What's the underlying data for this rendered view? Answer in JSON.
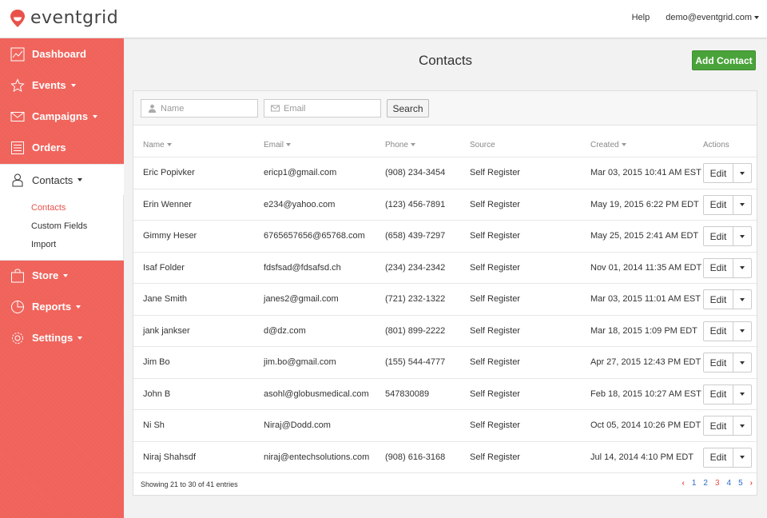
{
  "brand": {
    "name": "eventgrid",
    "color": "#e8524a"
  },
  "header": {
    "help": "Help",
    "user": "demo@eventgrid.com"
  },
  "sidebar": {
    "items": [
      {
        "label": "Dashboard",
        "icon": "chart-icon"
      },
      {
        "label": "Events",
        "icon": "star-icon"
      },
      {
        "label": "Campaigns",
        "icon": "envelope-icon"
      },
      {
        "label": "Orders",
        "icon": "list-icon"
      },
      {
        "label": "Contacts",
        "icon": "person-icon"
      },
      {
        "label": "Store",
        "icon": "bag-icon"
      },
      {
        "label": "Reports",
        "icon": "pie-icon"
      },
      {
        "label": "Settings",
        "icon": "gear-icon"
      }
    ],
    "subitems": [
      "Contacts",
      "Custom Fields",
      "Import"
    ]
  },
  "page": {
    "title": "Contacts",
    "add_label": "Add Contact"
  },
  "filters": {
    "name_placeholder": "Name",
    "email_placeholder": "Email",
    "search_label": "Search"
  },
  "table": {
    "columns": [
      "Name",
      "Email",
      "Phone",
      "Source",
      "Created",
      "Actions"
    ],
    "edit_label": "Edit",
    "rows": [
      {
        "name": "Eric Popivker",
        "email": "ericp1@gmail.com",
        "phone": "(908) 234-3454",
        "source": "Self Register",
        "created": "Mar 03, 2015 10:41 AM EST"
      },
      {
        "name": "Erin Wenner",
        "email": "e234@yahoo.com",
        "phone": "(123) 456-7891",
        "source": "Self Register",
        "created": "May 19, 2015 6:22 PM EDT"
      },
      {
        "name": "Gimmy Heser",
        "email": "6765657656@65768.com",
        "phone": "(658) 439-7297",
        "source": "Self Register",
        "created": "May 25, 2015 2:41 AM EDT"
      },
      {
        "name": "Isaf Folder",
        "email": "fdsfsad@fdsafsd.ch",
        "phone": "(234) 234-2342",
        "source": "Self Register",
        "created": "Nov 01, 2014 11:35 AM EDT"
      },
      {
        "name": "Jane Smith",
        "email": "janes2@gmail.com",
        "phone": "(721) 232-1322",
        "source": "Self Register",
        "created": "Mar 03, 2015 11:01 AM EST"
      },
      {
        "name": "jank jankser",
        "email": "d@dz.com",
        "phone": "(801) 899-2222",
        "source": "Self Register",
        "created": "Mar 18, 2015 1:09 PM EDT"
      },
      {
        "name": "Jim Bo",
        "email": "jim.bo@gmail.com",
        "phone": "(155) 544-4777",
        "source": "Self Register",
        "created": "Apr 27, 2015 12:43 PM EDT"
      },
      {
        "name": "John B",
        "email": "asohl@globusmedical.com",
        "phone": "547830089",
        "source": "Self Register",
        "created": "Feb 18, 2015 10:27 AM EST"
      },
      {
        "name": "Ni Sh",
        "email": "Niraj@Dodd.com",
        "phone": "",
        "source": "Self Register",
        "created": "Oct 05, 2014 10:26 PM EDT"
      },
      {
        "name": "Niraj Shahsdf",
        "email": "niraj@entechsolutions.com",
        "phone": "(908) 616-3168",
        "source": "Self Register",
        "created": "Jul 14, 2014 4:10 PM EDT"
      }
    ]
  },
  "footer": {
    "info": "Showing 21 to 30 of 41 entries",
    "prev": "‹",
    "next": "›",
    "pages": [
      "1",
      "2",
      "3",
      "4",
      "5"
    ],
    "current_page": "3"
  }
}
